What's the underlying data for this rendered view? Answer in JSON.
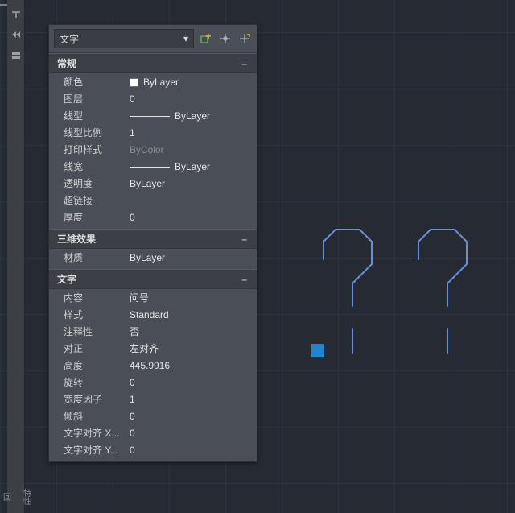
{
  "object_type": "文字",
  "toolbar_icons": [
    "add-to-selection",
    "pick",
    "quick-select"
  ],
  "sections": {
    "general": {
      "title": "常规",
      "rows": [
        {
          "label": "颜色",
          "value": "ByLayer",
          "swatch": true
        },
        {
          "label": "图层",
          "value": "0"
        },
        {
          "label": "线型",
          "value": "ByLayer",
          "line": true
        },
        {
          "label": "线型比例",
          "value": "1"
        },
        {
          "label": "打印样式",
          "value": "ByColor",
          "dim": true
        },
        {
          "label": "线宽",
          "value": "ByLayer",
          "line": true
        },
        {
          "label": "透明度",
          "value": "ByLayer"
        },
        {
          "label": "超链接",
          "value": ""
        },
        {
          "label": "厚度",
          "value": "0"
        }
      ]
    },
    "fx3d": {
      "title": "三维效果",
      "rows": [
        {
          "label": "材质",
          "value": "ByLayer"
        }
      ]
    },
    "text": {
      "title": "文字",
      "rows": [
        {
          "label": "内容",
          "value": "问号"
        },
        {
          "label": "样式",
          "value": "Standard"
        },
        {
          "label": "注释性",
          "value": "否"
        },
        {
          "label": "对正",
          "value": "左对齐"
        },
        {
          "label": "高度",
          "value": "445.9916"
        },
        {
          "label": "旋转",
          "value": "0"
        },
        {
          "label": "宽度因子",
          "value": "1"
        },
        {
          "label": "倾斜",
          "value": "0"
        },
        {
          "label": "文字对齐 X...",
          "value": "0"
        },
        {
          "label": "文字对齐 Y...",
          "value": "0"
        }
      ]
    }
  },
  "sidebar": {
    "tip1": "特性",
    "tip2": "回"
  }
}
